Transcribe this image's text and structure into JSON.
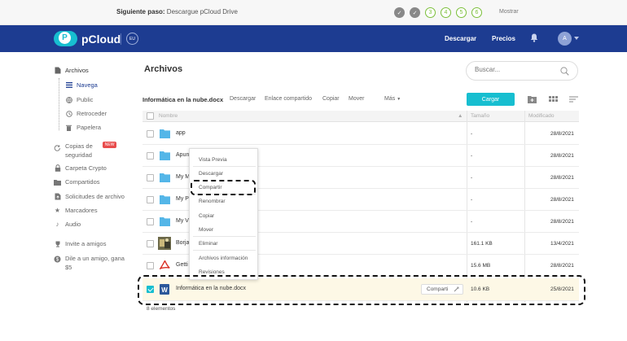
{
  "onboarding": {
    "next_step_label": "Siguiente paso:",
    "next_step_text": "Descargue pCloud Drive",
    "steps": [
      {
        "label": "✓",
        "state": "done"
      },
      {
        "label": "✓",
        "state": "done"
      },
      {
        "label": "3",
        "state": "todo"
      },
      {
        "label": "4",
        "state": "todo"
      },
      {
        "label": "5",
        "state": "todo"
      },
      {
        "label": "6",
        "state": "todo"
      }
    ],
    "show_label": "Mostrar"
  },
  "header": {
    "brand": "pCloud",
    "brand_letter": "P",
    "eu_badge": "EU",
    "download": "Descargar",
    "pricing": "Precios",
    "avatar_initial": "A"
  },
  "sidebar": {
    "files": "Archivos",
    "browse": "Navega",
    "public": "Public",
    "rewind": "Retroceder",
    "trash": "Papelera",
    "backups_1": "Copias de",
    "backups_2": "seguridad",
    "new_badge": "NEW",
    "crypto": "Carpeta Crypto",
    "shared": "Compartidos",
    "file_requests": "Solicitudes de archivo",
    "bookmarks": "Marcadores",
    "audio": "Audio",
    "invite": "Invite a amigos",
    "tell_1": "Dile a un amigo, gana",
    "tell_2": "$5"
  },
  "main": {
    "title": "Archivos",
    "search_placeholder": "Buscar...",
    "toolbar": {
      "selected_name": "Informática en la nube.docx",
      "download": "Descargar",
      "shared_link": "Enlace compartido",
      "copy": "Copiar",
      "move": "Mover",
      "more": "Más",
      "upload": "Cargar"
    },
    "columns": {
      "name": "Nombre",
      "size": "Tamaño",
      "modified": "Modificado"
    },
    "rows": [
      {
        "name": "app",
        "size": "-",
        "date": "28/8/2021"
      },
      {
        "name": "Apun",
        "size": "-",
        "date": "28/8/2021"
      },
      {
        "name": "My M",
        "size": "-",
        "date": "28/8/2021"
      },
      {
        "name": "My P",
        "size": "-",
        "date": "28/8/2021"
      },
      {
        "name": "My V",
        "size": "-",
        "date": "28/8/2021"
      },
      {
        "name": "Borja",
        "size": "161.1 KB",
        "date": "13/4/2021"
      },
      {
        "name": "Getti",
        "size": "15.6 MB",
        "date": "28/8/2021"
      },
      {
        "name": "Informática en la nube.docx",
        "size": "10.6 KB",
        "date": "25/8/2021",
        "share": "Comparti"
      }
    ],
    "count": "8 elementos"
  },
  "context_menu": {
    "preview": "Vista Previa",
    "download": "Descargar",
    "share": "Compartir",
    "rename": "Renombrar",
    "copy": "Copiar",
    "move": "Mover",
    "delete": "Eliminar",
    "info": "Archivos información",
    "revisions": "Revisiones"
  },
  "colors": {
    "header": "#1d3c91",
    "accent": "#17bed0",
    "folder": "#54b6e8",
    "selected_row": "#fdf8e6"
  }
}
